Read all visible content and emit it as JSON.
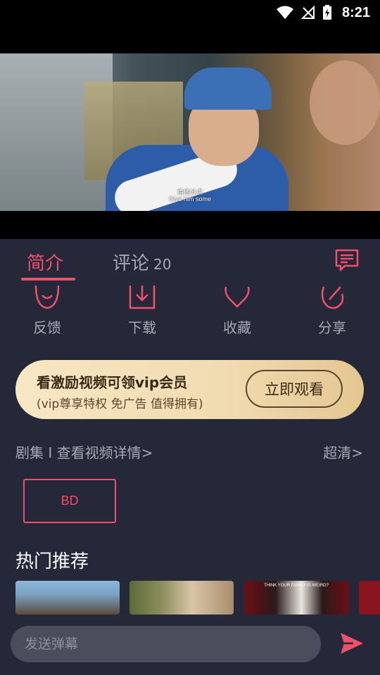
{
  "status_bar": {
    "time": "8:21"
  },
  "video": {
    "subtitle_cn": "给他分点",
    "subtitle_en": "Give him some"
  },
  "tabs": {
    "intro_label": "简介",
    "comments_label": "评论",
    "comments_count": "20"
  },
  "actions": [
    {
      "label": "反馈",
      "icon": "feedback-icon"
    },
    {
      "label": "下载",
      "icon": "download-icon"
    },
    {
      "label": "收藏",
      "icon": "heart-icon"
    },
    {
      "label": "分享",
      "icon": "share-icon"
    }
  ],
  "vip_banner": {
    "title": "看激励视频可领vip会员",
    "subtitle": "(vip尊享特权 免广告 值得拥有)",
    "button_label": "立即观看"
  },
  "episodes": {
    "link_label": "剧集 I 查看视频详情>",
    "quality_label": "超清>",
    "items": [
      "BD"
    ]
  },
  "hot": {
    "title": "热门推荐",
    "thumb_captions": [
      "",
      "",
      "THINK YOUR FAMILY IS WEIRD?",
      ""
    ]
  },
  "danmu": {
    "placeholder": "发送弹幕"
  },
  "colors": {
    "accent": "#f24f6a",
    "panel_bg": "#252839",
    "muted_text": "#a6a8b4"
  }
}
